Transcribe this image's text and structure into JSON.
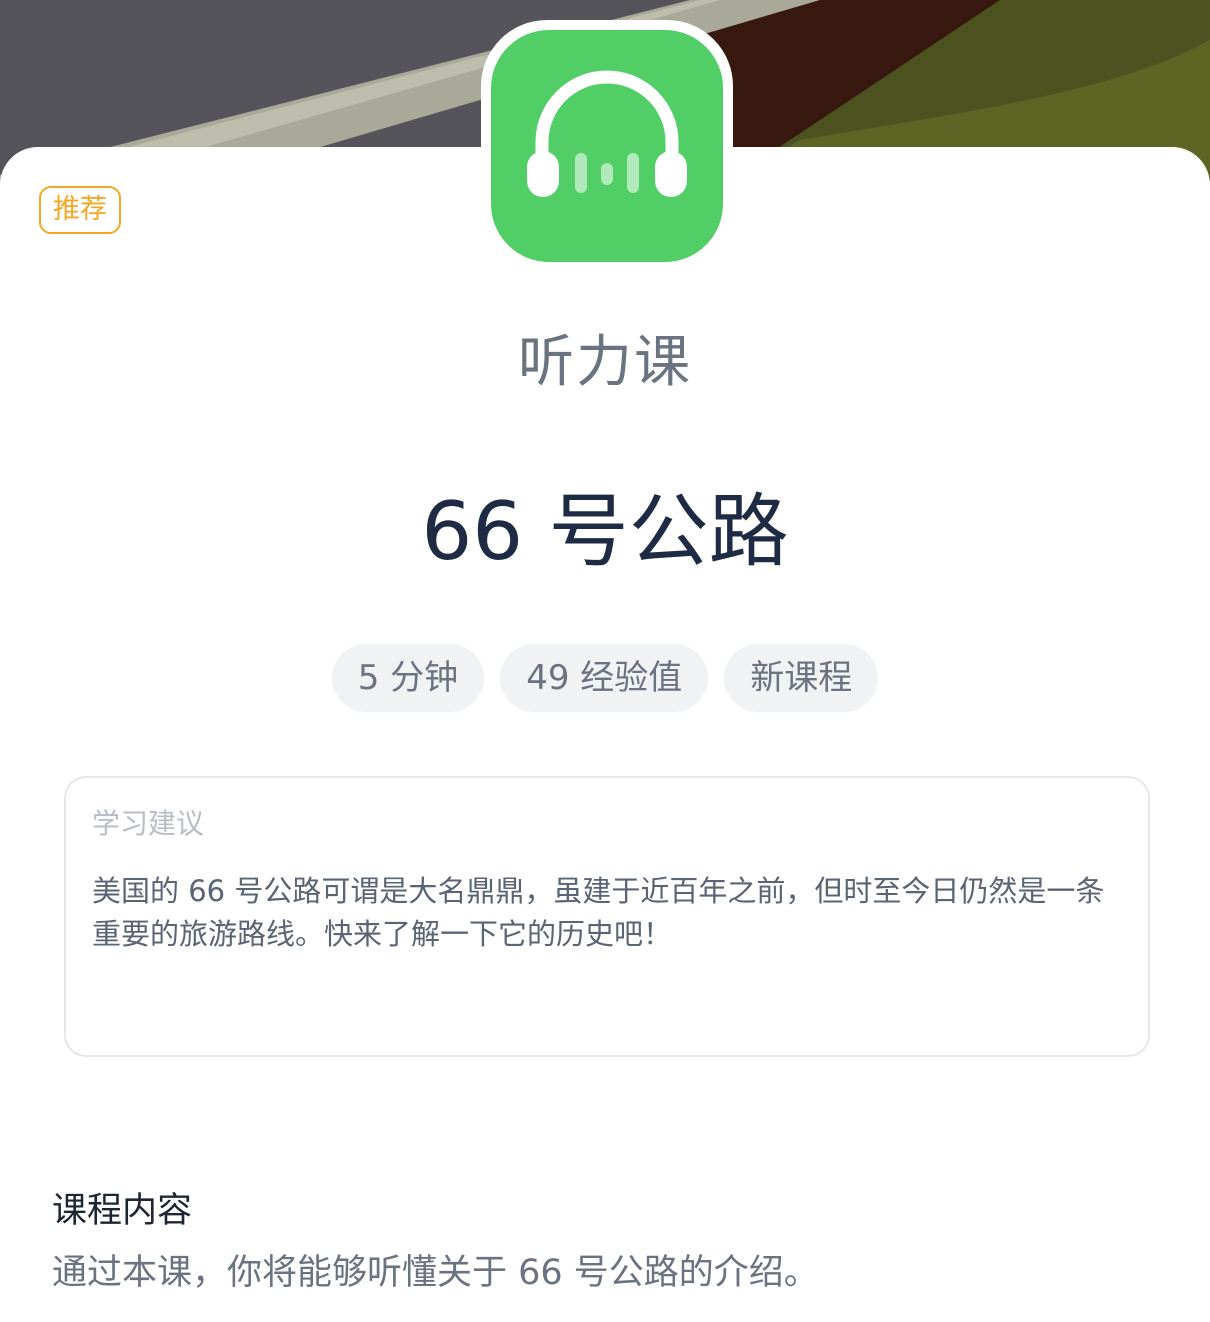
{
  "badge": {
    "label": "推荐"
  },
  "course": {
    "icon": "headphones-icon",
    "type": "听力课",
    "title": "66 号公路"
  },
  "meta_chips": [
    "5 分钟",
    "49 经验值",
    "新课程"
  ],
  "advice": {
    "label": "学习建议",
    "text": "美国的 66 号公路可谓是大名鼎鼎，虽建于近百年之前，但时至今日仍然是一条重要的旅游路线。快来了解一下它的历史吧！"
  },
  "content": {
    "title": "课程内容",
    "description": "通过本课，你将能够听懂关于 66 号公路的介绍。"
  },
  "colors": {
    "accent_green": "#51cf66",
    "badge_orange": "#f5a623",
    "title_text": "#1f2a44",
    "muted_text": "#6b7280"
  }
}
